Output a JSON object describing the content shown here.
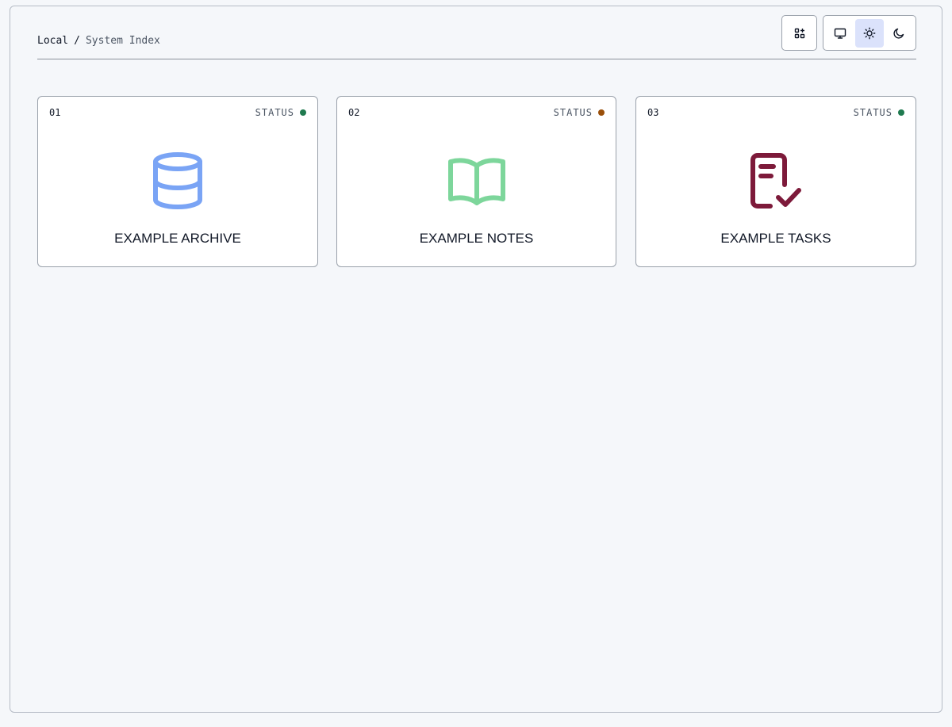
{
  "breadcrumb": {
    "root": "Local",
    "separator": "/",
    "current": "System Index"
  },
  "toolbar": {
    "apps_icon": "apps-grid-icon",
    "theme_options": [
      {
        "name": "system",
        "icon": "monitor-icon",
        "active": false
      },
      {
        "name": "light",
        "icon": "sun-icon",
        "active": true
      },
      {
        "name": "dark",
        "icon": "moon-icon",
        "active": false
      }
    ]
  },
  "cards": [
    {
      "number": "01",
      "status_label": "STATUS",
      "status_color": "#1f7a4f",
      "icon": "database-icon",
      "icon_color": "#7aa4f5",
      "title": "EXAMPLE ARCHIVE"
    },
    {
      "number": "02",
      "status_label": "STATUS",
      "status_color": "#9a4f0a",
      "icon": "book-open-icon",
      "icon_color": "#7dd69b",
      "title": "EXAMPLE NOTES"
    },
    {
      "number": "03",
      "status_label": "STATUS",
      "status_color": "#1f7a4f",
      "icon": "clipboard-check-icon",
      "icon_color": "#7d1a3a",
      "title": "EXAMPLE TASKS"
    }
  ]
}
